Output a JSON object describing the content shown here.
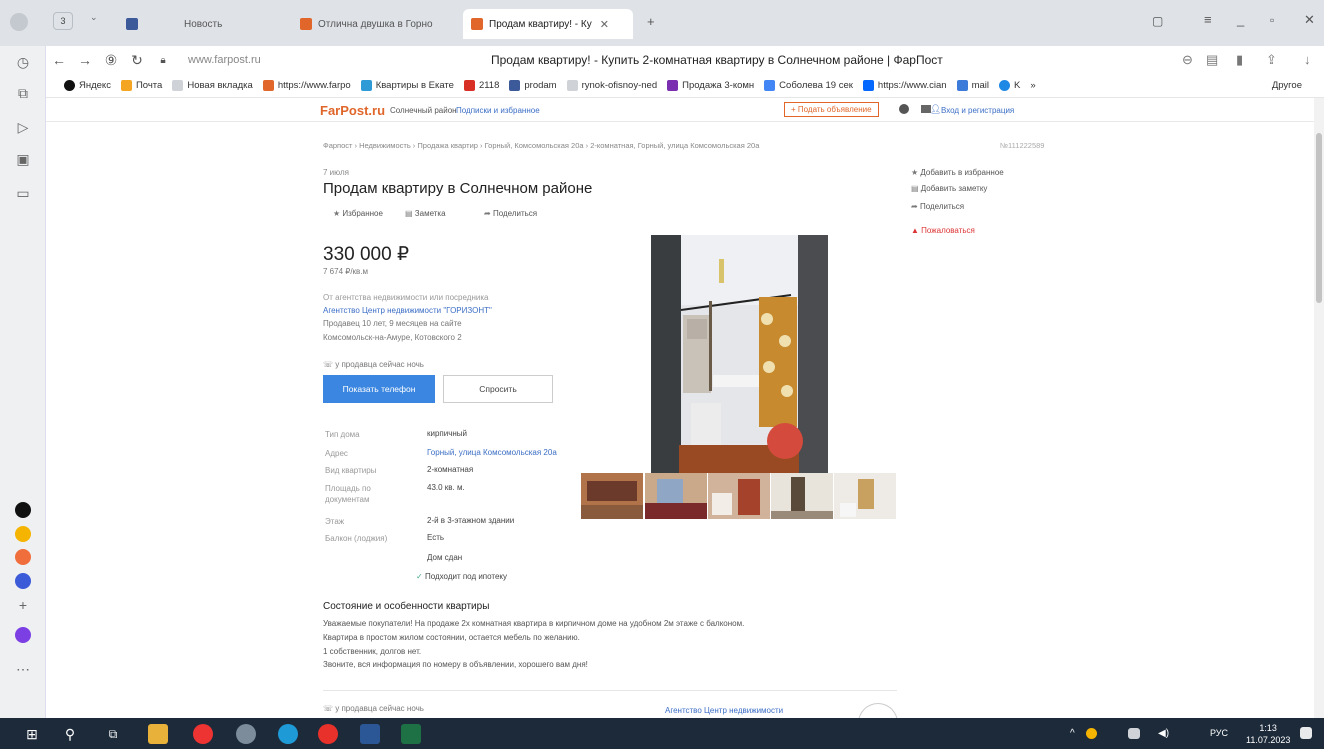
{
  "tabs": [
    {
      "title": "Новость"
    },
    {
      "title": "Отлична двушка в Горно"
    },
    {
      "title": "Продам квартиру! - Ку"
    }
  ],
  "tab_counter": "3",
  "address": {
    "url": "www.farpost.ru",
    "title": "Продам квартиру! - Купить 2-комнатная квартиру в Солнечном районе | ФарПост"
  },
  "bookmarks": [
    {
      "label": "Яндекс",
      "color": "#111111"
    },
    {
      "label": "Почта",
      "color": "#f4a623"
    },
    {
      "label": "Новая вкладка",
      "color": "#cfd3d8"
    },
    {
      "label": "https://www.farpo",
      "color": "#e0662a"
    },
    {
      "label": "Квартиры в Екате",
      "color": "#2e9bd6"
    },
    {
      "label": "2118",
      "color": "#d93025"
    },
    {
      "label": "prodam",
      "color": "#3c5a9a"
    },
    {
      "label": "rynok-ofisnoy-ned",
      "color": "#cfd3d8"
    },
    {
      "label": "Продажа 3-комн",
      "color": "#7a2fb0"
    },
    {
      "label": "Соболева 19 сек",
      "color": "#4285f4"
    },
    {
      "label": "https://www.cian",
      "color": "#0468ff"
    },
    {
      "label": "mail",
      "color": "#3c7bd9"
    },
    {
      "label": "K",
      "color": "#1e88e5"
    }
  ],
  "bookmarks_more": "»",
  "bookmarks_other": "Другое",
  "site": {
    "logo": "FarPost.ru",
    "region": "Солнечный район",
    "subscriptions": "Подписки и избранное",
    "post_ad": "+ Подать объявление",
    "login": "Вход и регистрация"
  },
  "breadcrumbs": "Фарпост › Недвижимость › Продажа квартир › Горный, Комсомольская 20а › 2-комнатная, Горный, улица Комсомольская 20а",
  "ad_id": "№111222589",
  "listing": {
    "date": "7 июля",
    "title": "Продам квартиру в Солнечном районе",
    "actions": [
      "Избранное",
      "Заметка",
      "Поделиться"
    ],
    "price": "330 000 ₽",
    "price_per_m2": "7 674 ₽/кв.м",
    "seller_note": "От агентства недвижимости или посредника",
    "agency": "Агентство Центр недвижимости \"ГОРИЗОНТ\"",
    "seller_age": "Продавец 10 лет, 9 месяцев на сайте",
    "location": "Комсомольск-на-Амуре, Котовского 2",
    "night_note": "у продавца сейчас ночь",
    "show_phone": "Показать телефон",
    "ask": "Спросить"
  },
  "properties": [
    {
      "key": "Тип дома",
      "value": "кирпичный",
      "link": false
    },
    {
      "key": "Адрес",
      "value": "Горный, улица Комсомольская 20а",
      "link": true
    },
    {
      "key": "Вид квартиры",
      "value": "2-комнатная",
      "link": false
    },
    {
      "key": "Площадь по документам",
      "value": "43.0 кв. м.",
      "link": false
    },
    {
      "key": "Этаж",
      "value": "2-й в 3-этажном здании",
      "link": false
    },
    {
      "key": "Балкон (лоджия)",
      "value": "Есть",
      "link": false
    }
  ],
  "extras": [
    "Дом сдан",
    "Подходит под ипотеку"
  ],
  "description": {
    "title": "Состояние и особенности квартиры",
    "lines": [
      "Уважаемые покупатели! На продаже 2х комнатная квартира в кирпичном доме на удобном 2м этаже с балконом.",
      "Квартира в простом жилом состоянии, остается мебель по желанию.",
      "1 собственник, долгов нет.",
      "Звоните, вся информация по номеру в объявлении, хорошего вам дня!"
    ]
  },
  "footer": {
    "night_note": "у продавца сейчас ночь",
    "agency": "Агентство Центр недвижимости"
  },
  "sidebar_actions": [
    "Добавить в избранное",
    "Добавить заметку",
    "Поделиться",
    "Пожаловаться"
  ],
  "tray": {
    "lang": "РУС",
    "time": "1:13",
    "date": "11.07.2023"
  }
}
